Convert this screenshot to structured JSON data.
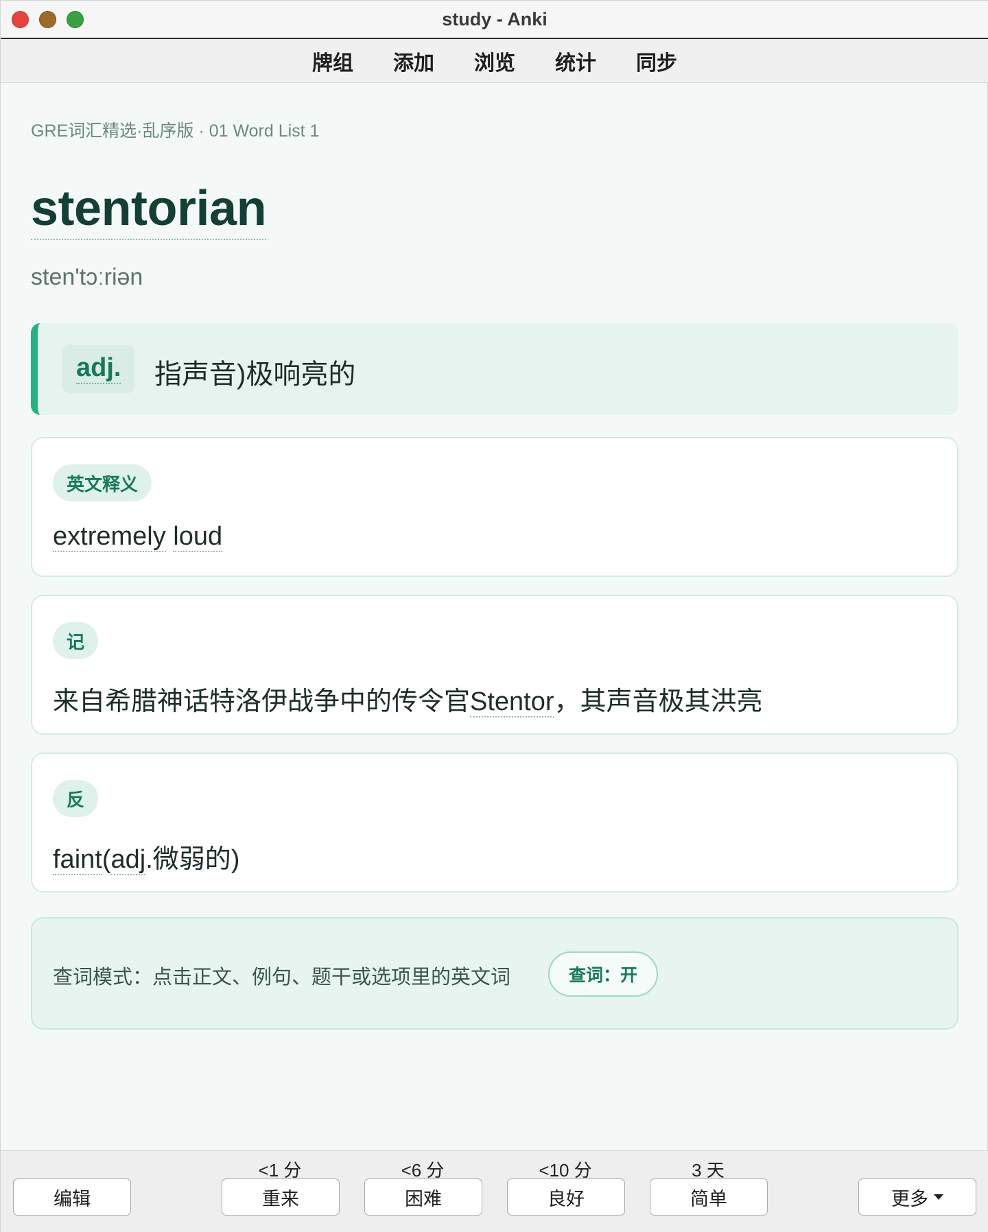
{
  "window": {
    "title": "study - Anki"
  },
  "toolbar": {
    "items": [
      "牌组",
      "添加",
      "浏览",
      "统计",
      "同步"
    ]
  },
  "card": {
    "deck_path": "GRE词汇精选·乱序版 · 01 Word List 1",
    "word": "stentorian",
    "phonetic": "sten'tɔːriən",
    "definition": {
      "pos": "adj.",
      "meaning": "指声音)极响亮的"
    },
    "english_def": {
      "tag": "英文释义",
      "words": [
        "extremely",
        "loud"
      ]
    },
    "mnemonic": {
      "tag": "记",
      "before": "来自希腊神话特洛伊战争中的传令官",
      "keyword": "Stentor",
      "after": "，其声音极其洪亮"
    },
    "antonym": {
      "tag": "反",
      "word": "faint",
      "paren_open": "(",
      "pos": "adj",
      "rest": ".微弱的)"
    },
    "lookup": {
      "text": "查词模式：点击正文、例句、题干或选项里的英文词",
      "toggle_label": "查词：开"
    }
  },
  "bottom": {
    "edit_label": "编辑",
    "more_label": "更多",
    "answers": [
      {
        "interval": "<1 分",
        "label": "重来"
      },
      {
        "interval": "<6 分",
        "label": "困难"
      },
      {
        "interval": "<10 分",
        "label": "良好"
      },
      {
        "interval": "3 天",
        "label": "简单"
      }
    ]
  },
  "colors": {
    "accent": "#28b083",
    "headword": "#143f34",
    "tag_text": "#167a58",
    "background": "#f4f9f8"
  }
}
